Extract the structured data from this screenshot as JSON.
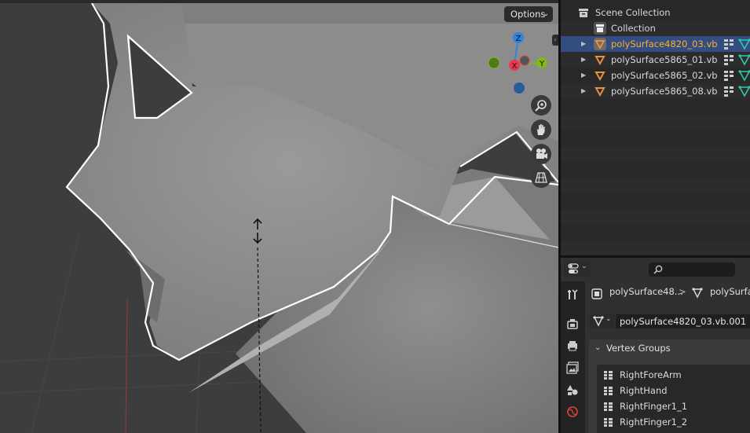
{
  "viewport": {
    "options_label": "Options",
    "gizmo": {
      "z": "Z",
      "x": "X",
      "y": "Y"
    },
    "nav_icons": [
      "zoom-icon",
      "hand-pan-icon",
      "camera-icon",
      "grid-perspective-icon"
    ]
  },
  "outliner": {
    "scene_label": "Scene Collection",
    "collection_label": "Collection",
    "objects": [
      {
        "name": "polySurface4820_03.vb",
        "selected": true
      },
      {
        "name": "polySurface5865_01.vb",
        "selected": false
      },
      {
        "name": "polySurface5865_02.vb",
        "selected": false
      },
      {
        "name": "polySurface5865_08.vb",
        "selected": false
      }
    ]
  },
  "properties": {
    "breadcrumb_object": "polySurface48...",
    "breadcrumb_separator": ">",
    "breadcrumb_mesh": "polySurfac",
    "mesh_name": "polySurface4820_03.vb.001",
    "panel_title": "Vertex Groups",
    "vertex_groups": [
      "RightForeArm",
      "RightHand",
      "RightFinger1_1",
      "RightFinger1_2"
    ]
  },
  "colors": {
    "accent_selected_row": "#334d80",
    "selected_text": "#ffaf29",
    "object_icon": "#e8903a",
    "mesh_icon": "#30c9a8",
    "axis_x": "#e8394f",
    "axis_y": "#82b81d",
    "axis_z": "#2f83e0"
  }
}
